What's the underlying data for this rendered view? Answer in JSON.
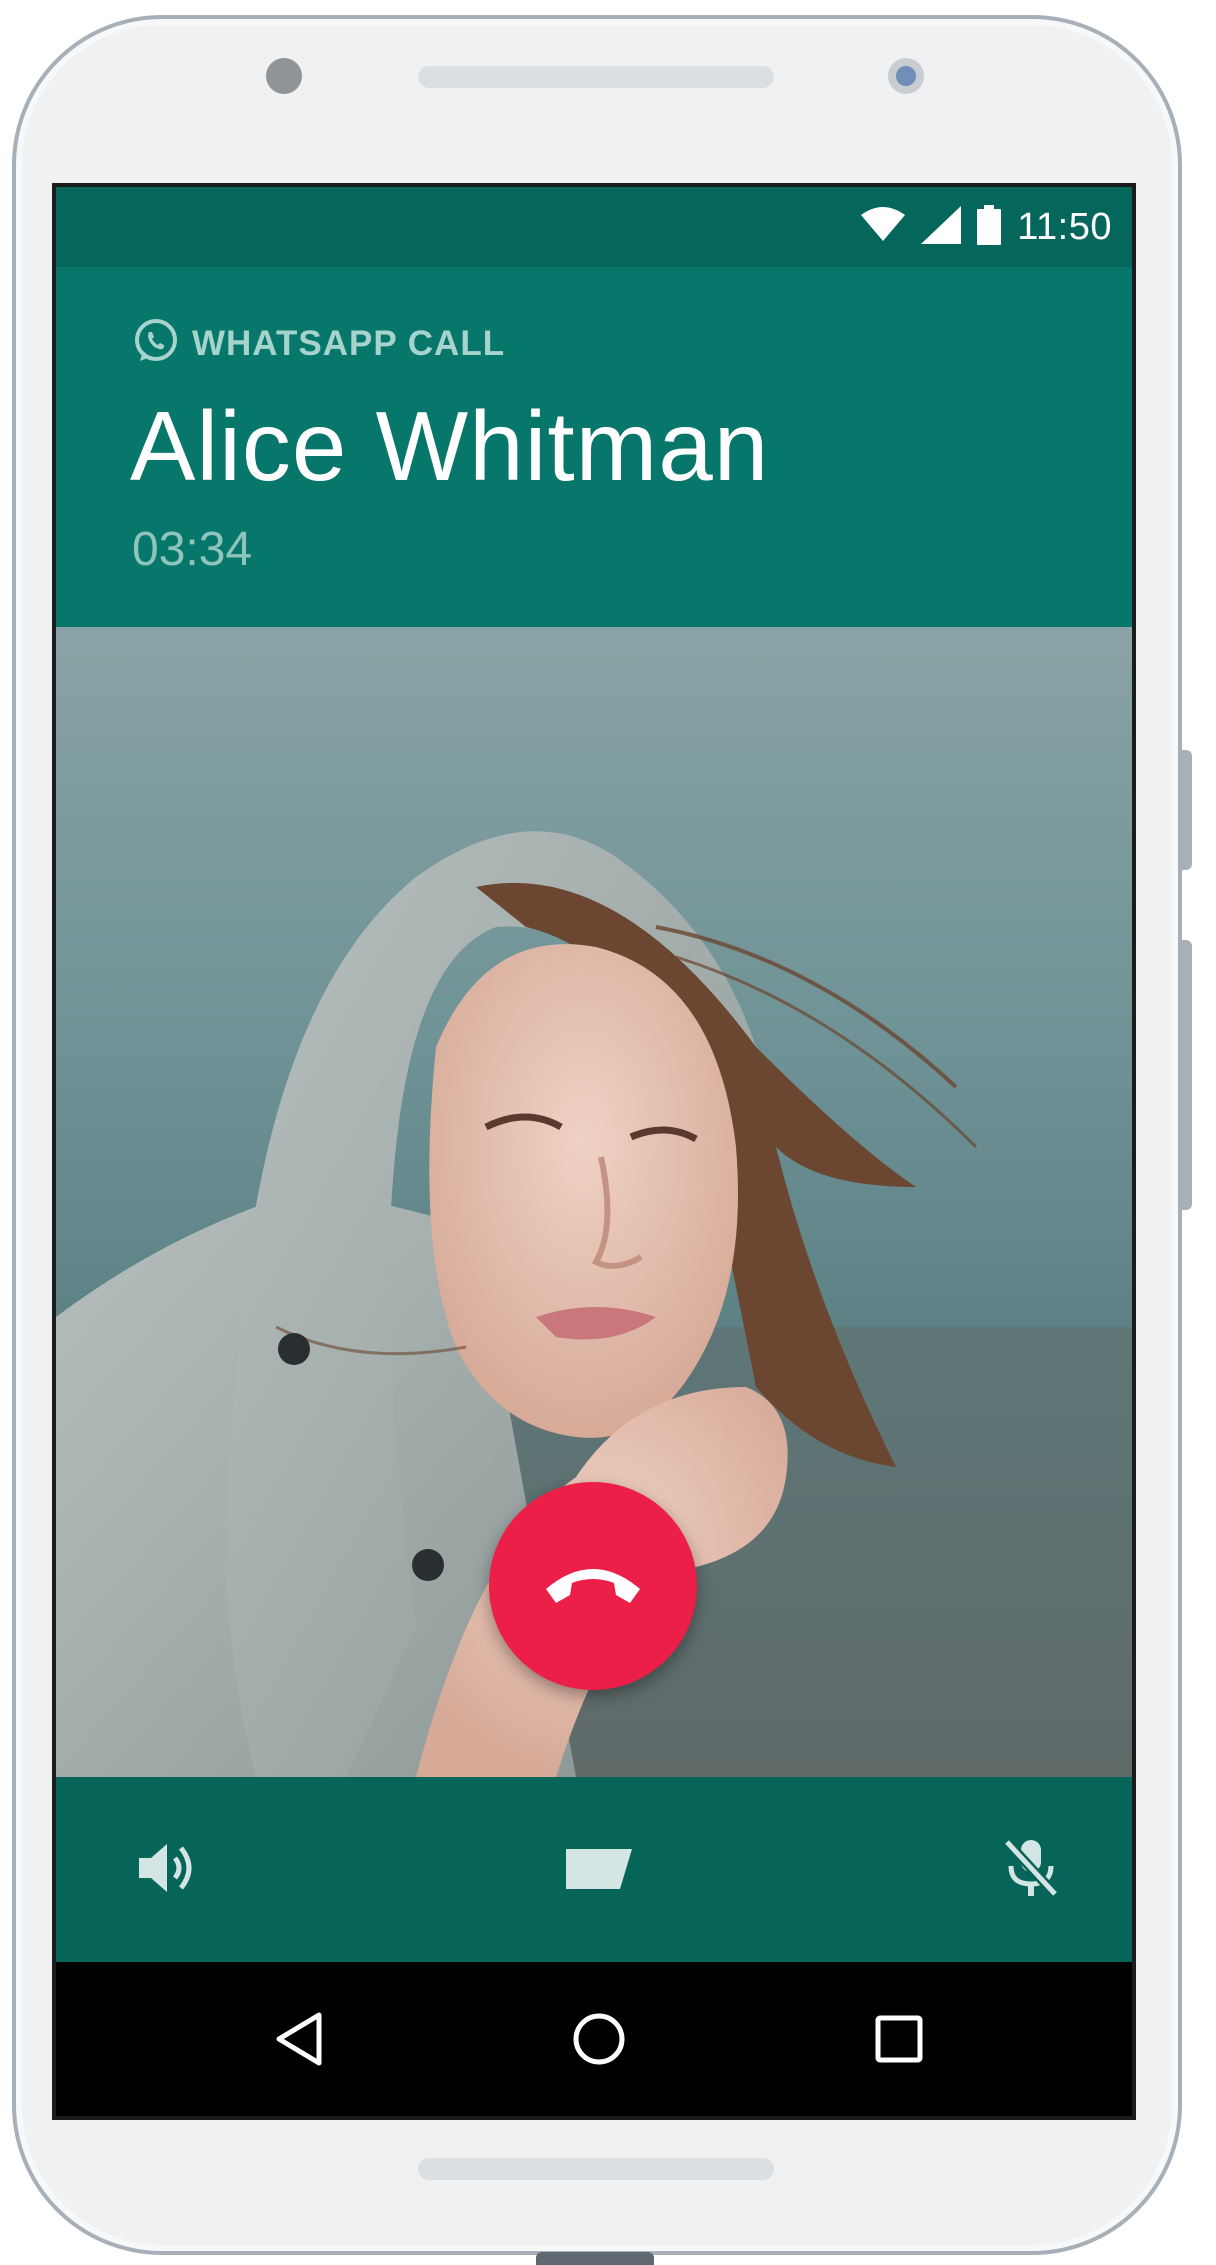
{
  "status_bar": {
    "time": "11:50",
    "icons": [
      "wifi-icon",
      "signal-icon",
      "battery-icon"
    ]
  },
  "call": {
    "label": "WHATSAPP CALL",
    "contact_name": "Alice Whitman",
    "duration": "03:34",
    "label_icon": "whatsapp-icon"
  },
  "controls": {
    "speaker_icon": "speaker-icon",
    "video_icon": "video-icon",
    "mute_icon": "mic-off-icon",
    "end_call_icon": "end-call-icon"
  },
  "navigation": {
    "back_icon": "back-icon",
    "home_icon": "home-icon",
    "recents_icon": "recents-icon"
  },
  "colors": {
    "status_bar": "#05665c",
    "header": "#08776b",
    "controls_bar": "#066459",
    "end_call": "#eb1f48",
    "label_text": "#a7d3cd"
  }
}
